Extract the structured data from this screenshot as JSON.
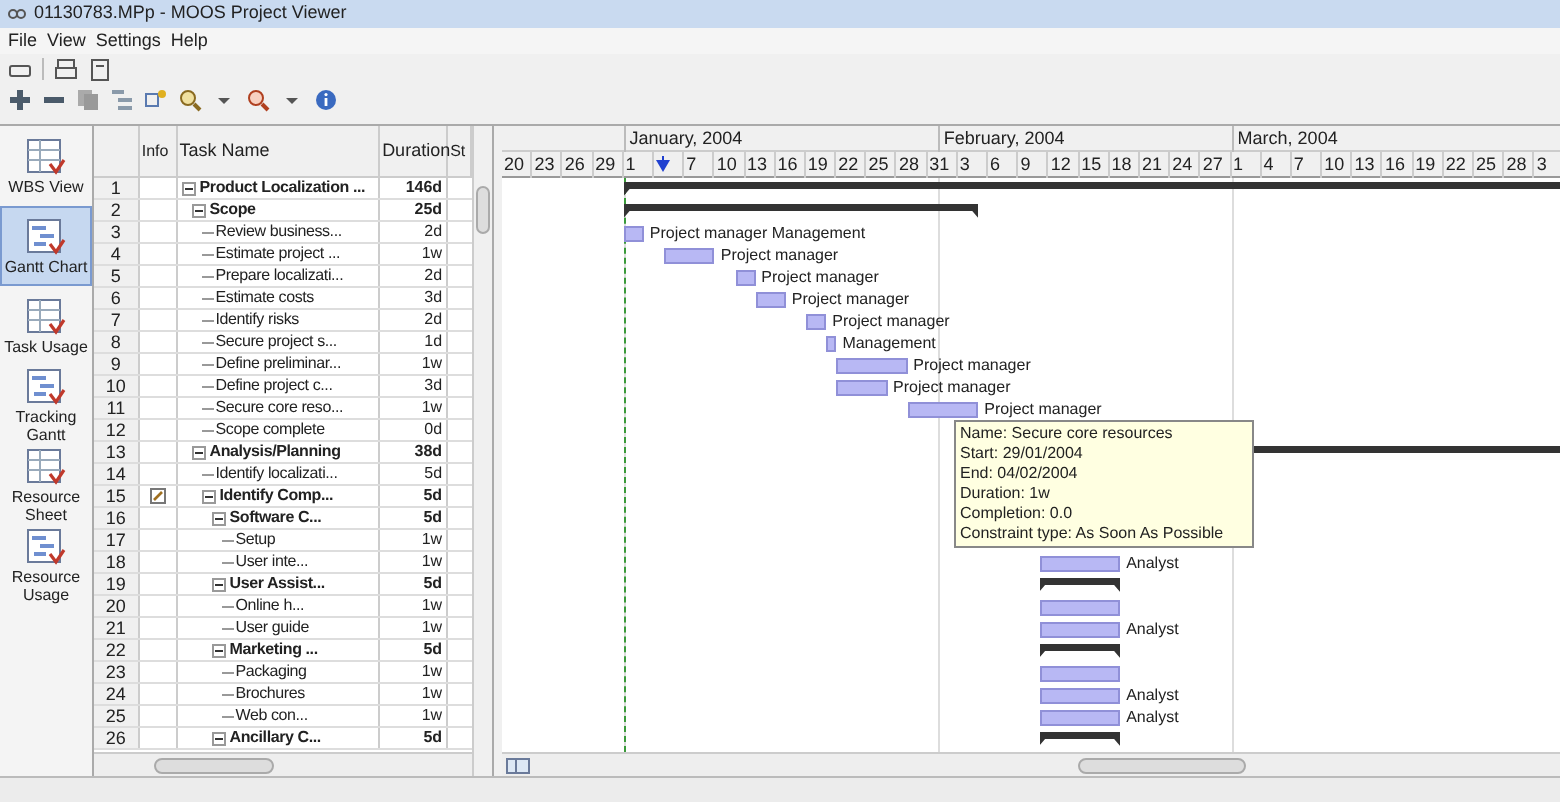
{
  "window": {
    "title": "01130783.MPp - MOOS Project Viewer"
  },
  "menu": [
    {
      "label": "File"
    },
    {
      "label": "View"
    },
    {
      "label": "Settings"
    },
    {
      "label": "Help"
    }
  ],
  "sidebar": {
    "items": [
      {
        "label": "WBS View",
        "selected": false
      },
      {
        "label": "Gantt Chart",
        "selected": true
      },
      {
        "label": "Task Usage",
        "selected": false
      },
      {
        "label": "Tracking Gantt",
        "selected": false
      },
      {
        "label": "Resource Sheet",
        "selected": false
      },
      {
        "label": "Resource Usage",
        "selected": false
      }
    ]
  },
  "table": {
    "columns": [
      "Info",
      "Task Name",
      "Duration",
      "St"
    ],
    "rows": [
      {
        "id": "1",
        "name": "Product Localization ...",
        "duration": "146d",
        "kind": "summary",
        "expanded": true,
        "note": false,
        "bar": {
          "kind": "summary"
        },
        "children": [
          {
            "id": "2",
            "name": "Scope",
            "duration": "25d",
            "kind": "summary",
            "expanded": true,
            "note": false,
            "bar": {
              "kind": "summary"
            },
            "children": [
              {
                "id": "3",
                "name": "Review business...",
                "duration": "2d",
                "kind": "task",
                "note": false,
                "bar": {
                  "kind": "task",
                  "label": "Project manager Management"
                }
              },
              {
                "id": "4",
                "name": "Estimate project ...",
                "duration": "1w",
                "kind": "task",
                "note": false,
                "bar": {
                  "kind": "task",
                  "label": "Project manager"
                }
              },
              {
                "id": "5",
                "name": "Prepare localizati...",
                "duration": "2d",
                "kind": "task",
                "note": false,
                "bar": {
                  "kind": "task",
                  "label": "Project manager"
                }
              },
              {
                "id": "6",
                "name": "Estimate costs",
                "duration": "3d",
                "kind": "task",
                "note": false,
                "bar": {
                  "kind": "task",
                  "label": "Project manager"
                }
              },
              {
                "id": "7",
                "name": "Identify risks",
                "duration": "2d",
                "kind": "task",
                "note": false,
                "bar": {
                  "kind": "task",
                  "label": "Project manager"
                }
              },
              {
                "id": "8",
                "name": "Secure project s...",
                "duration": "1d",
                "kind": "task",
                "note": false,
                "bar": {
                  "kind": "task",
                  "label": "Management"
                }
              },
              {
                "id": "9",
                "name": "Define preliminar...",
                "duration": "1w",
                "kind": "task",
                "note": false,
                "bar": {
                  "kind": "task",
                  "label": "Project manager"
                }
              },
              {
                "id": "10",
                "name": "Define project c...",
                "duration": "3d",
                "kind": "task",
                "note": false,
                "bar": {
                  "kind": "task",
                  "label": "Project manager"
                }
              },
              {
                "id": "11",
                "name": "Secure core reso...",
                "duration": "1w",
                "kind": "task",
                "note": false,
                "bar": {
                  "kind": "task",
                  "label": "Project manager"
                }
              },
              {
                "id": "12",
                "name": "Scope complete",
                "duration": "0d",
                "kind": "task",
                "note": false
              }
            ]
          },
          {
            "id": "13",
            "name": "Analysis/Planning",
            "duration": "38d",
            "kind": "summary",
            "expanded": true,
            "note": false,
            "bar": {
              "kind": "summary"
            },
            "children": [
              {
                "id": "14",
                "name": "Identify localizati...",
                "duration": "5d",
                "kind": "task",
                "note": false
              },
              {
                "id": "15",
                "name": "Identify Comp...",
                "duration": "5d",
                "kind": "summary",
                "expanded": true,
                "note": true,
                "children": [
                  {
                    "id": "16",
                    "name": "Software C...",
                    "duration": "5d",
                    "kind": "summary",
                    "expanded": true,
                    "note": false,
                    "children": [
                      {
                        "id": "17",
                        "name": "Setup",
                        "duration": "1w",
                        "kind": "task",
                        "note": false
                      },
                      {
                        "id": "18",
                        "name": "User inte...",
                        "duration": "1w",
                        "kind": "task",
                        "note": false,
                        "bar": {
                          "kind": "task",
                          "label": "Analyst"
                        }
                      }
                    ]
                  },
                  {
                    "id": "19",
                    "name": "User Assist...",
                    "duration": "5d",
                    "kind": "summary",
                    "expanded": true,
                    "note": false,
                    "bar": {
                      "kind": "summary"
                    },
                    "children": [
                      {
                        "id": "20",
                        "name": "Online h...",
                        "duration": "1w",
                        "kind": "task",
                        "note": false,
                        "bar": {
                          "kind": "task"
                        }
                      },
                      {
                        "id": "21",
                        "name": "User guide",
                        "duration": "1w",
                        "kind": "task",
                        "note": false,
                        "bar": {
                          "kind": "task",
                          "label": "Analyst"
                        }
                      }
                    ]
                  },
                  {
                    "id": "22",
                    "name": "Marketing ...",
                    "duration": "5d",
                    "kind": "summary",
                    "expanded": true,
                    "note": false,
                    "bar": {
                      "kind": "summary"
                    },
                    "children": [
                      {
                        "id": "23",
                        "name": "Packaging",
                        "duration": "1w",
                        "kind": "task",
                        "note": false,
                        "bar": {
                          "kind": "task"
                        }
                      },
                      {
                        "id": "24",
                        "name": "Brochures",
                        "duration": "1w",
                        "kind": "task",
                        "note": false,
                        "bar": {
                          "kind": "task",
                          "label": "Analyst"
                        }
                      },
                      {
                        "id": "25",
                        "name": "Web con...",
                        "duration": "1w",
                        "kind": "task",
                        "note": false,
                        "bar": {
                          "kind": "task",
                          "label": "Analyst"
                        }
                      }
                    ]
                  },
                  {
                    "id": "26",
                    "name": "Ancillary C...",
                    "duration": "5d",
                    "kind": "summary",
                    "expanded": true,
                    "note": false,
                    "bar": {
                      "kind": "summary"
                    }
                  }
                ]
              }
            ]
          }
        ]
      }
    ]
  },
  "gantt": {
    "months": [
      {
        "label": "January, 2004"
      },
      {
        "label": "February, 2004"
      },
      {
        "label": "March, 2004"
      }
    ],
    "days": [
      {
        "label": "20"
      },
      {
        "label": "23"
      },
      {
        "label": "26"
      },
      {
        "label": "29"
      },
      {
        "label": "1"
      },
      {
        "today": true
      },
      {
        "label": "7"
      },
      {
        "label": "10"
      },
      {
        "label": "13"
      },
      {
        "label": "16"
      },
      {
        "label": "19"
      },
      {
        "label": "22"
      },
      {
        "label": "25"
      },
      {
        "label": "28"
      },
      {
        "label": "31"
      },
      {
        "label": "3"
      },
      {
        "label": "6"
      },
      {
        "label": "9"
      },
      {
        "label": "12"
      },
      {
        "label": "15"
      },
      {
        "label": "18"
      },
      {
        "label": "21"
      },
      {
        "label": "24"
      },
      {
        "label": "27"
      },
      {
        "label": "1"
      },
      {
        "label": "4"
      },
      {
        "label": "7"
      },
      {
        "label": "10"
      },
      {
        "label": "13"
      },
      {
        "label": "16"
      },
      {
        "label": "19"
      },
      {
        "label": "22"
      },
      {
        "label": "25"
      },
      {
        "label": "28"
      },
      {
        "label": "3"
      }
    ],
    "tooltip": {
      "lines": [
        "Name: Secure core resources",
        "Start: 29/01/2004",
        "End: 04/02/2004",
        "Duration: 1w",
        "Completion: 0.0",
        "Constraint type: As Soon As Possible"
      ]
    }
  }
}
